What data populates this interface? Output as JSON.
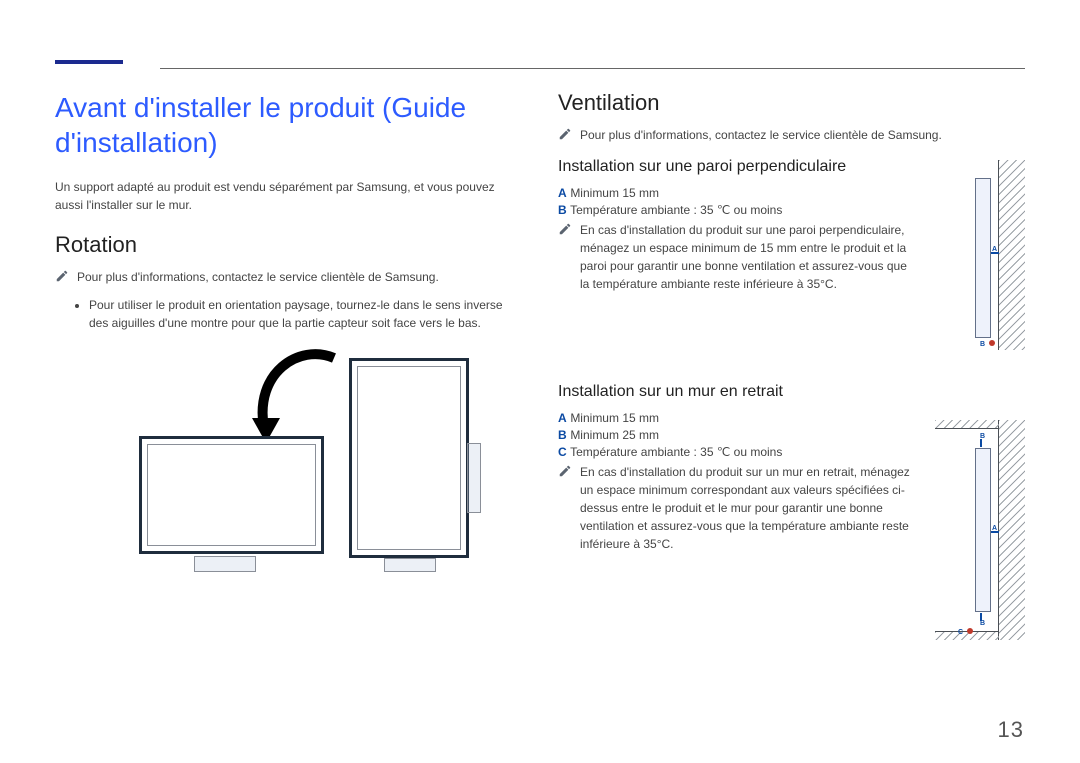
{
  "title": "Avant d'installer le produit (Guide d'installation)",
  "intro": "Un support adapté au produit est vendu séparément par Samsung, et vous pouvez aussi l'installer sur le mur.",
  "rotation": {
    "heading": "Rotation",
    "note": "Pour plus d'informations, contactez le service clientèle de Samsung.",
    "bullet": "Pour utiliser le produit en orientation paysage, tournez-le dans le sens inverse des aiguilles d'une montre pour que la partie capteur soit face vers le bas."
  },
  "ventilation": {
    "heading": "Ventilation",
    "note": "Pour plus d'informations, contactez le service clientèle de Samsung.",
    "perp": {
      "heading": "Installation sur une paroi perpendiculaire",
      "a_key": "A",
      "a_val": "Minimum 15 mm",
      "b_key": "B",
      "b_val": "Température ambiante : 35 ℃ ou moins",
      "note": "En cas d'installation du produit sur une paroi perpendiculaire, ménagez un espace minimum de 15 mm entre le produit et la paroi pour garantir une bonne ventilation et assurez-vous que la température ambiante reste inférieure à 35°C."
    },
    "retrait": {
      "heading": "Installation sur un mur en retrait",
      "a_key": "A",
      "a_val": "Minimum 15 mm",
      "b_key": "B",
      "b_val": "Minimum 25 mm",
      "c_key": "C",
      "c_val": "Température ambiante : 35 ℃ ou moins",
      "note": "En cas d'installation du produit sur un mur en retrait, ménagez un espace minimum correspondant aux valeurs spécifiées ci-dessus entre le produit et le mur pour garantir une bonne ventilation et assurez-vous que la température ambiante reste inférieure à 35°C."
    }
  },
  "labels": {
    "A": "A",
    "B": "B",
    "C": "C"
  },
  "page_number": "13"
}
